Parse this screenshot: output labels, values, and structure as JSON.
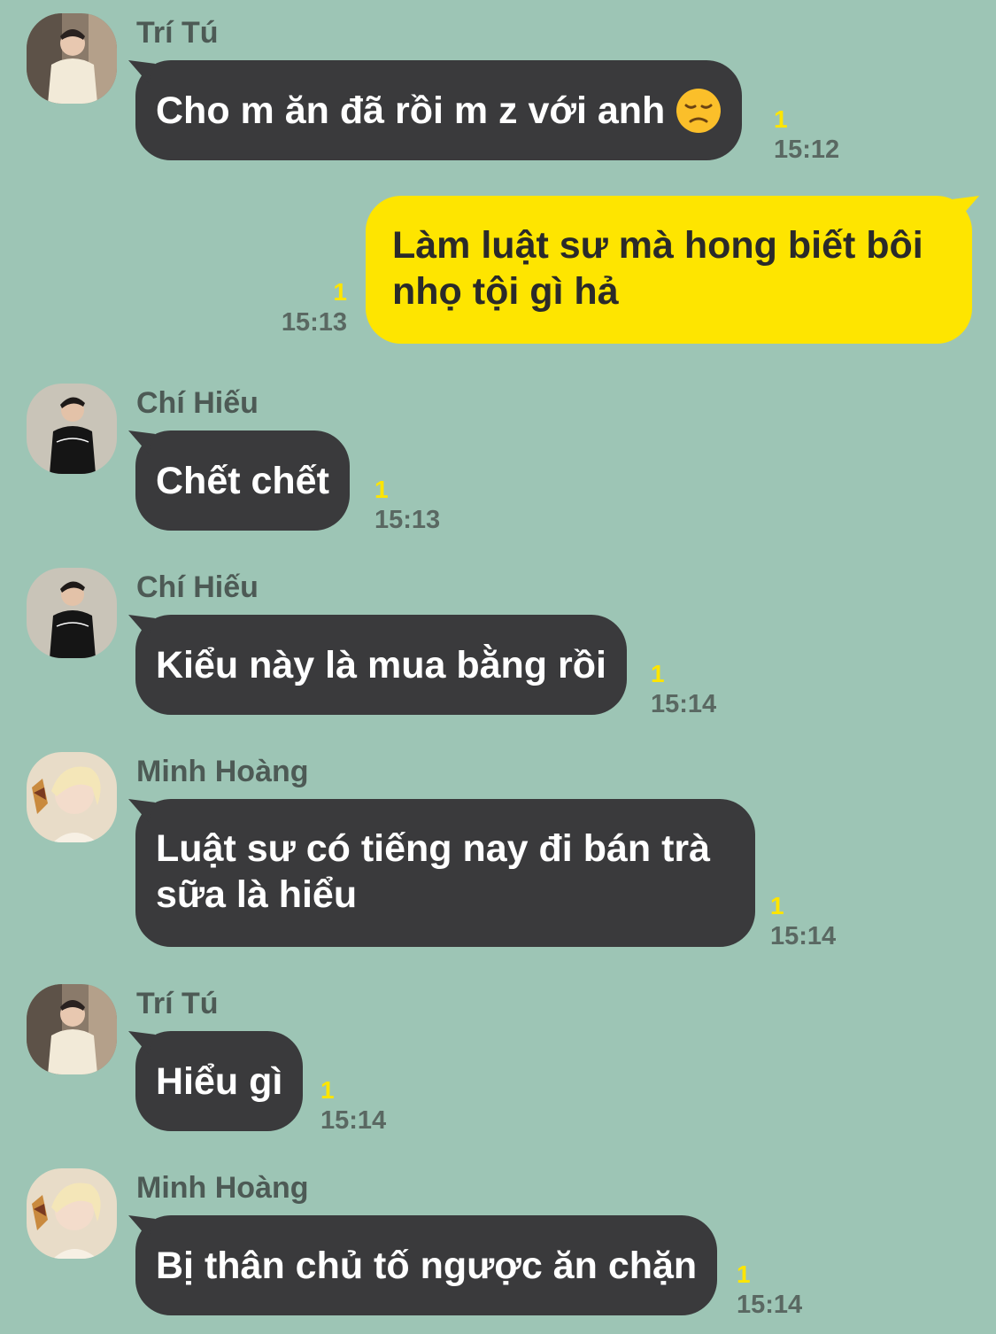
{
  "messages": [
    {
      "sender": "Trí Tú",
      "text": "Cho m ăn đã rồi m z với anh",
      "emoji": "disappointed-face-icon",
      "unread": "1",
      "time": "15:12"
    },
    {
      "sender": "",
      "text": "Làm luật sư mà hong biết bôi nhọ tội gì hả",
      "unread": "1",
      "time": "15:13",
      "mine": true
    },
    {
      "sender": "Chí Hiếu",
      "text": "Chết chết",
      "unread": "1",
      "time": "15:13"
    },
    {
      "sender": "Chí Hiếu",
      "text": "Kiểu này là mua bằng rồi",
      "unread": "1",
      "time": "15:14"
    },
    {
      "sender": "Minh Hoàng",
      "text": "Luật sư có tiếng nay đi bán trà sữa là hiểu",
      "unread": "1",
      "time": "15:14"
    },
    {
      "sender": "Trí Tú",
      "text": "Hiểu gì",
      "unread": "1",
      "time": "15:14"
    },
    {
      "sender": "Minh Hoàng",
      "text": "Bị thân chủ tố ngược ăn chặn",
      "unread": "1",
      "time": "15:14"
    }
  ],
  "colors": {
    "background": "#9dc5b5",
    "incoming_bubble": "#3a3a3c",
    "outgoing_bubble": "#fee500",
    "unread_count": "#fee500"
  }
}
